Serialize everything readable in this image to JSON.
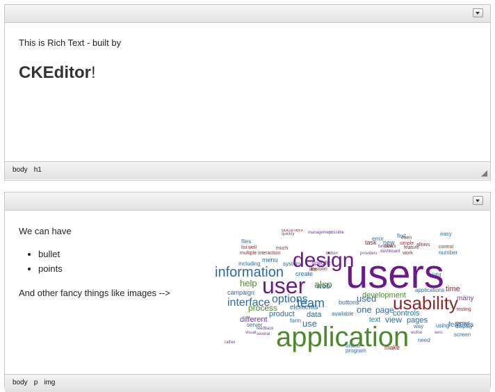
{
  "editor1": {
    "paragraph": "This is Rich Text - built by",
    "heading_bold": "CKEditor",
    "heading_tail": "!",
    "statusbar": {
      "crumbs": [
        "body",
        "h1"
      ]
    }
  },
  "editor2": {
    "paragraph1": "We can have",
    "bullets": [
      "bullet",
      "points"
    ],
    "paragraph2": "And other fancy things like images -->",
    "statusbar": {
      "crumbs": [
        "body",
        "p",
        "img"
      ]
    }
  },
  "wordcloud": {
    "words": [
      "users",
      "application",
      "design",
      "user",
      "information",
      "usability",
      "team",
      "interface",
      "features",
      "also",
      "development",
      "process",
      "options",
      "buttons",
      "help",
      "web",
      "pages",
      "view",
      "one",
      "data",
      "page",
      "use",
      "used",
      "text",
      "product",
      "different",
      "elements",
      "create",
      "make",
      "controls",
      "many",
      "time",
      "applications",
      "campaign",
      "new",
      "task",
      "menu",
      "system",
      "specific",
      "error",
      "including",
      "display",
      "using",
      "screen",
      "way",
      "first",
      "easy",
      "number",
      "right",
      "available",
      "server",
      "form",
      "online",
      "program",
      "need",
      "files",
      "list",
      "multiple",
      "well",
      "much",
      "work",
      "feature",
      "allows",
      "simple",
      "even",
      "tasks",
      "control",
      "testing",
      "menus",
      "interaction",
      "like",
      "document",
      "mission",
      "quickly",
      "management",
      "possible",
      "button",
      "rather",
      "several",
      "visual",
      "feedback",
      "providers",
      "dashboard",
      "function",
      "xero",
      "wufoo"
    ]
  }
}
